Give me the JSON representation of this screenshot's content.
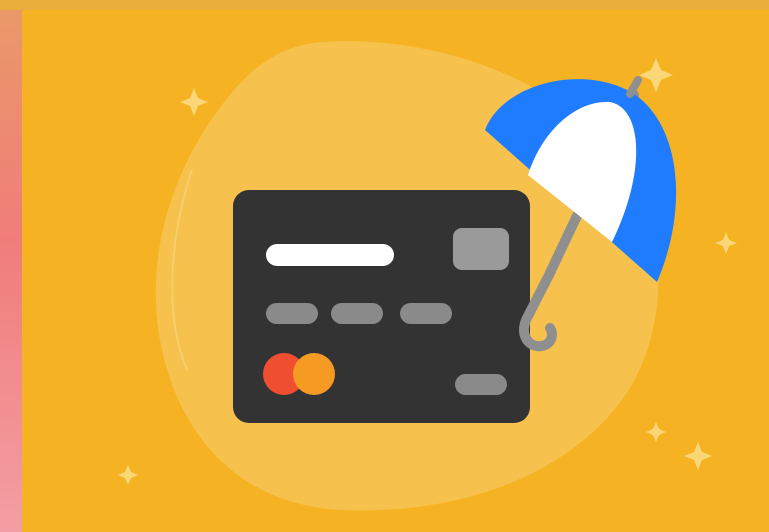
{
  "colors": {
    "side_gradient_top": "#e99a68",
    "side_gradient_bottom": "#f39ea4",
    "background": "#f5b324",
    "blob": "#f6c455",
    "card": "#333333",
    "card_stripe": "#ffffff",
    "card_chip": "#9a9a9a",
    "card_numbers": "#8a8a8a",
    "logo_left": "#f04e31",
    "logo_right": "#f59b23",
    "umbrella_blue": "#1f7cff",
    "umbrella_white": "#ffffff",
    "umbrella_handle": "#8f8f8f",
    "sparkle": "#fbd777"
  },
  "illustration": {
    "subject": "credit-card-protected-by-umbrella",
    "icons": [
      "credit-card-icon",
      "umbrella-icon",
      "sparkle-icon"
    ]
  }
}
